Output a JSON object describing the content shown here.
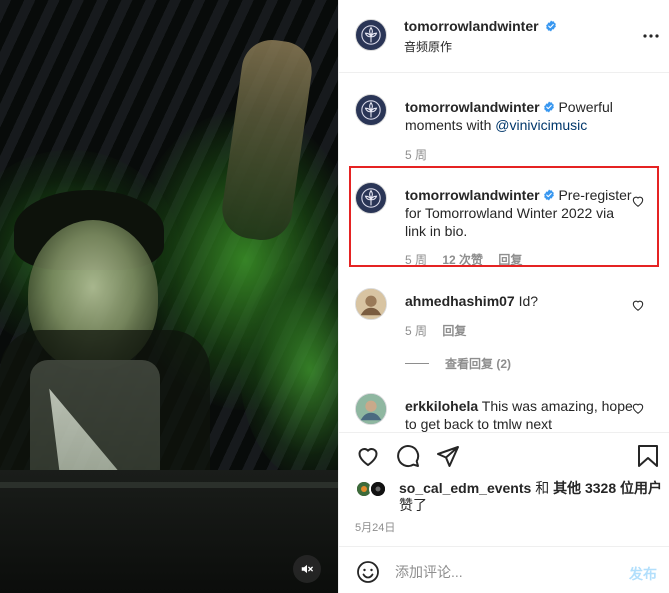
{
  "media": {
    "mute_icon": "mute-speaker-icon"
  },
  "header": {
    "username": "tomorrowlandwinter",
    "subtitle": "音频原作",
    "more_icon": "more-dots-icon"
  },
  "comments": [
    {
      "username": "tomorrowlandwinter",
      "text": "Powerful moments with ",
      "mention": "@vinivicimusic",
      "time": "5 周",
      "likes": "",
      "reply": ""
    },
    {
      "username": "tomorrowlandwinter",
      "text": "Pre-register for Tomorrowland Winter 2022 via link in bio.",
      "time": "5 周",
      "likes": "12 次赞",
      "reply": "回复",
      "highlighted": true
    },
    {
      "username": "ahmedhashim07",
      "text": "Id?",
      "time": "5 周",
      "reply": "回复",
      "view_replies": "查看回复 (2)"
    },
    {
      "username": "erkkilohela",
      "text": "This was amazing, hope to get back to tmlw next",
      "time": "",
      "reply": ""
    }
  ],
  "actions": {
    "like_icon": "heart-icon",
    "comment_icon": "comment-bubble-icon",
    "share_icon": "paper-plane-icon",
    "save_icon": "bookmark-icon"
  },
  "likes": {
    "user": "so_cal_edm_events",
    "conj": " 和 ",
    "others": "其他 3328 位用户",
    "suffix": "赞了"
  },
  "date": "5月24日",
  "add_comment": {
    "placeholder": "添加评论...",
    "post_label": "发布",
    "emoji_icon": "emoji-smile-icon"
  },
  "colors": {
    "verified_blue": "#3897f0",
    "highlight_red": "#e52323",
    "post_disabled": "#b2dffc",
    "muted_text": "#8e8e8e",
    "mention": "#00376b"
  }
}
